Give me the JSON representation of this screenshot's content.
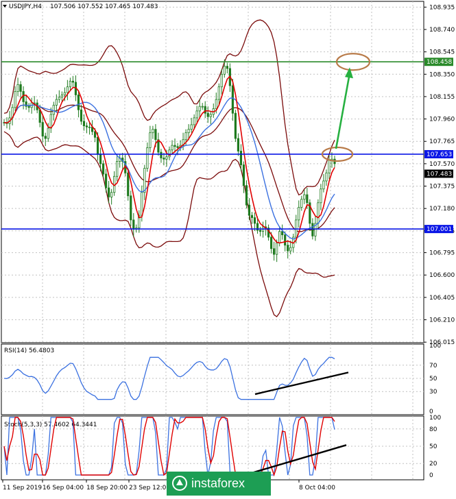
{
  "header": {
    "symbol": "USDJPY,H4",
    "ohlc": "107.506 107.552 107.465 107.483"
  },
  "main": {
    "y_ticks": [
      "108.935",
      "108.740",
      "108.545",
      "108.350",
      "108.155",
      "107.960",
      "107.765",
      "107.570",
      "107.375",
      "107.180",
      "106.985",
      "106.795",
      "106.600",
      "106.405",
      "106.210",
      "106.015"
    ],
    "labels": {
      "res_high": "108.458",
      "res_mid": "107.653",
      "support": "107.001",
      "last_price": "107.483"
    },
    "colors": {
      "green": "#2a8a2a",
      "blue": "#0a16e6",
      "candle": "#1e7a1e",
      "red_ma": "#e00000",
      "blue_ma": "#3a70e0",
      "bands": "#7a0a0a",
      "arrow": "#26b040",
      "ellipse": "#b87a48"
    }
  },
  "rsi": {
    "label": "RSI(14) 56.4803",
    "ticks": [
      "100",
      "70",
      "50",
      "30",
      "0"
    ]
  },
  "stoch": {
    "label": "Stoch(5,3,3) 57.4602 64.3441",
    "ticks": [
      "100",
      "80",
      "50",
      "20",
      "0"
    ]
  },
  "x_ticks": [
    "11 Sep 2019",
    "16 Sep 04:00",
    "18 Sep 20:00",
    "23 Sep 12:00",
    "8 Oct 04:00"
  ],
  "watermark": "instaforex",
  "chart_data": {
    "type": "line",
    "x": [
      "t0",
      "t1",
      "t2",
      "t3",
      "t4",
      "t5",
      "t6",
      "t7",
      "t8",
      "t9",
      "t10",
      "t11",
      "t12",
      "t13",
      "t14",
      "t15",
      "t16",
      "t17",
      "t18",
      "t19",
      "t20",
      "t21",
      "t22",
      "t23",
      "t24",
      "t25",
      "t26",
      "t27",
      "t28",
      "t29",
      "t30",
      "t31",
      "t32",
      "t33",
      "t34",
      "t35",
      "t36",
      "t37",
      "t38",
      "t39",
      "t40",
      "t41",
      "t42",
      "t43",
      "t44",
      "t45",
      "t46",
      "t47",
      "t48",
      "t49",
      "t50",
      "t51",
      "t52",
      "t53",
      "t54",
      "t55",
      "t56",
      "t57",
      "t58",
      "t59",
      "t60",
      "t61",
      "t62",
      "t63",
      "t64",
      "t65",
      "t66",
      "t67",
      "t68",
      "t69",
      "t70",
      "t71",
      "t72",
      "t73",
      "t74",
      "t75",
      "t76",
      "t77",
      "t78",
      "t79",
      "t80",
      "t81",
      "t82",
      "t83",
      "t84",
      "t85",
      "t86",
      "t87",
      "t88",
      "t89",
      "t90",
      "t91",
      "t92",
      "t93",
      "t94",
      "t95",
      "t96",
      "t97",
      "t98",
      "t99",
      "t100",
      "t101",
      "t102",
      "t103",
      "t104",
      "t105",
      "t106",
      "t107",
      "t108",
      "t109",
      "t110",
      "t111",
      "t112",
      "t113",
      "t114",
      "t115",
      "t116",
      "t117",
      "t118",
      "t119",
      "t120",
      "t121",
      "t122",
      "t123",
      "t124",
      "t125",
      "t126",
      "t127",
      "t128",
      "t129",
      "t130",
      "t131",
      "t132",
      "t133",
      "t134",
      "t135",
      "t136",
      "t137",
      "t138",
      "t139",
      "t140",
      "t141",
      "t142",
      "t143",
      "t144",
      "t145",
      "t146",
      "t147",
      "t148",
      "t149",
      "t150",
      "t151",
      "t152",
      "t153",
      "t154",
      "t155",
      "t156",
      "t157",
      "t158",
      "t159",
      "t160",
      "t161",
      "t162",
      "t163",
      "t164",
      "t165",
      "t166",
      "t167",
      "t168",
      "t169",
      "t170",
      "t171",
      "t172",
      "t173",
      "t174",
      "t175",
      "t176",
      "t177",
      "t178",
      "t179"
    ],
    "close": [
      107.93,
      107.92,
      107.97,
      108.06,
      108.2,
      108.26,
      108.2,
      108.11,
      108.07,
      108.06,
      108.1,
      108.1,
      108.04,
      107.93,
      107.81,
      107.79,
      107.88,
      108.0,
      108.08,
      108.13,
      108.15,
      108.17,
      108.19,
      108.24,
      108.29,
      108.28,
      108.17,
      108.04,
      107.94,
      107.9,
      107.89,
      107.89,
      107.85,
      107.8,
      107.65,
      107.57,
      107.48,
      107.36,
      107.28,
      107.32,
      107.46,
      107.59,
      107.62,
      107.59,
      107.49,
      107.29,
      107.08,
      107.0,
      107.01,
      107.12,
      107.32,
      107.53,
      107.71,
      107.84,
      107.87,
      107.78,
      107.67,
      107.62,
      107.61,
      107.63,
      107.69,
      107.73,
      107.72,
      107.71,
      107.73,
      107.78,
      107.84,
      107.87,
      107.91,
      107.97,
      108.03,
      108.07,
      108.07,
      108.01,
      107.98,
      108.0,
      108.05,
      108.13,
      108.24,
      108.35,
      108.42,
      108.4,
      108.25,
      108.01,
      107.79,
      107.68,
      107.56,
      107.38,
      107.21,
      107.12,
      107.1,
      107.05,
      106.99,
      106.98,
      107.02,
      107.01,
      106.93,
      106.83,
      106.78,
      106.88,
      106.98,
      106.95,
      106.86,
      106.81,
      106.84,
      106.93,
      107.08,
      107.19,
      107.26,
      107.3,
      107.23,
      107.05,
      106.94,
      107.05,
      107.23,
      107.35,
      107.42,
      107.49,
      107.6,
      107.61,
      107.57
    ],
    "upper_band_label_y": [
      108.458
    ],
    "levels": [
      108.458,
      107.653,
      107.001
    ],
    "ylim": [
      106.0,
      109.0
    ]
  }
}
